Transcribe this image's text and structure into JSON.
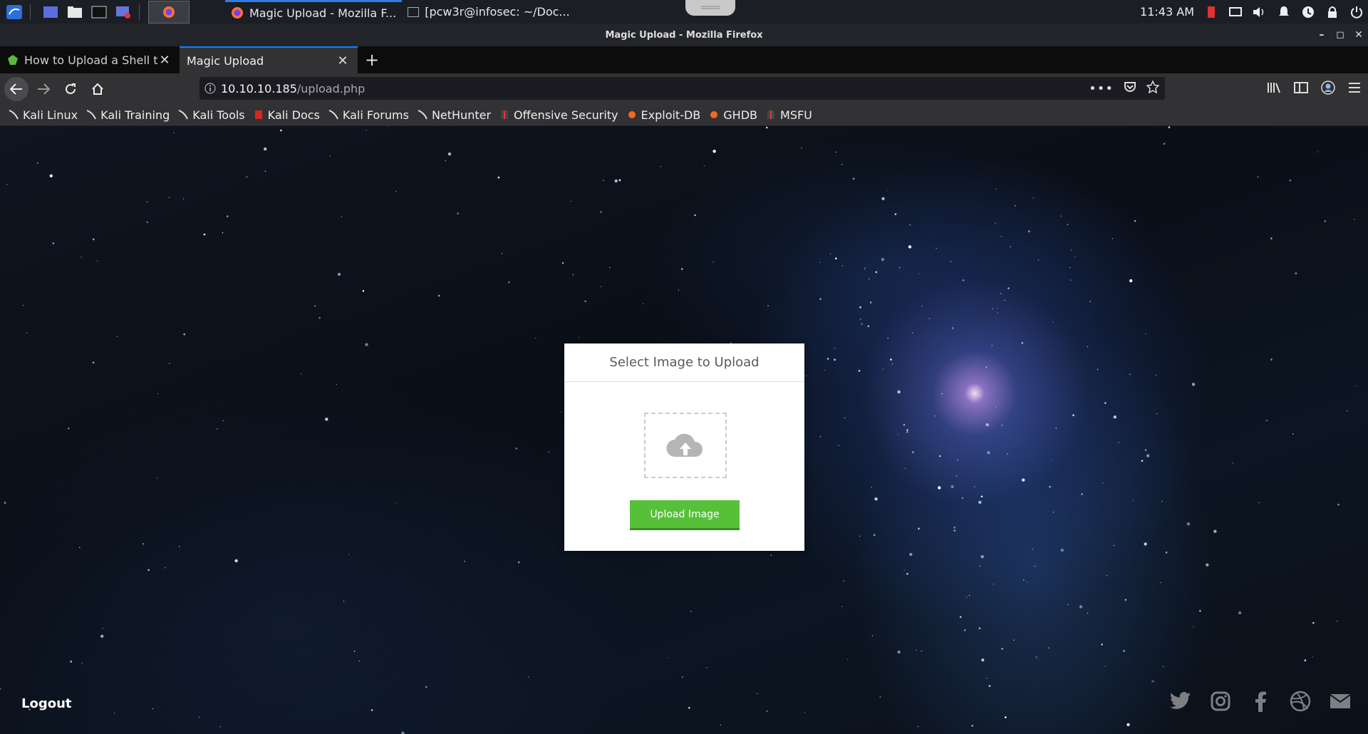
{
  "taskbar": {
    "windows": [
      {
        "label": "Magic Upload - Mozilla F..."
      },
      {
        "label": "[pcw3r@infosec: ~/Doc..."
      }
    ],
    "clock": "11:43 AM"
  },
  "window": {
    "title": "Magic Upload - Mozilla Firefox"
  },
  "tabs": [
    {
      "title": "How to Upload a Shell to",
      "active": false
    },
    {
      "title": "Magic Upload",
      "active": true
    }
  ],
  "urlbar": {
    "host": "10.10.10.185",
    "path": "/upload.php"
  },
  "bookmarks": [
    {
      "label": "Kali Linux",
      "icon": "kali-dragon-icon"
    },
    {
      "label": "Kali Training",
      "icon": "kali-dragon-icon"
    },
    {
      "label": "Kali Tools",
      "icon": "kali-dragon-icon"
    },
    {
      "label": "Kali Docs",
      "icon": "kali-docs-icon"
    },
    {
      "label": "Kali Forums",
      "icon": "kali-dragon-icon"
    },
    {
      "label": "NetHunter",
      "icon": "kali-dragon-icon"
    },
    {
      "label": "Offensive Security",
      "icon": "offsec-icon"
    },
    {
      "label": "Exploit-DB",
      "icon": "exploit-db-icon"
    },
    {
      "label": "GHDB",
      "icon": "exploit-db-icon"
    },
    {
      "label": "MSFU",
      "icon": "offsec-icon"
    }
  ],
  "page": {
    "card_title": "Select Image to Upload",
    "upload_button": "Upload Image",
    "logout": "Logout",
    "socials": [
      "twitter-icon",
      "instagram-icon",
      "facebook-icon",
      "dribbble-icon",
      "mail-icon"
    ]
  },
  "colors": {
    "accent": "#0a84ff",
    "upload_green": "#56c039",
    "chrome_bg": "#323234"
  }
}
